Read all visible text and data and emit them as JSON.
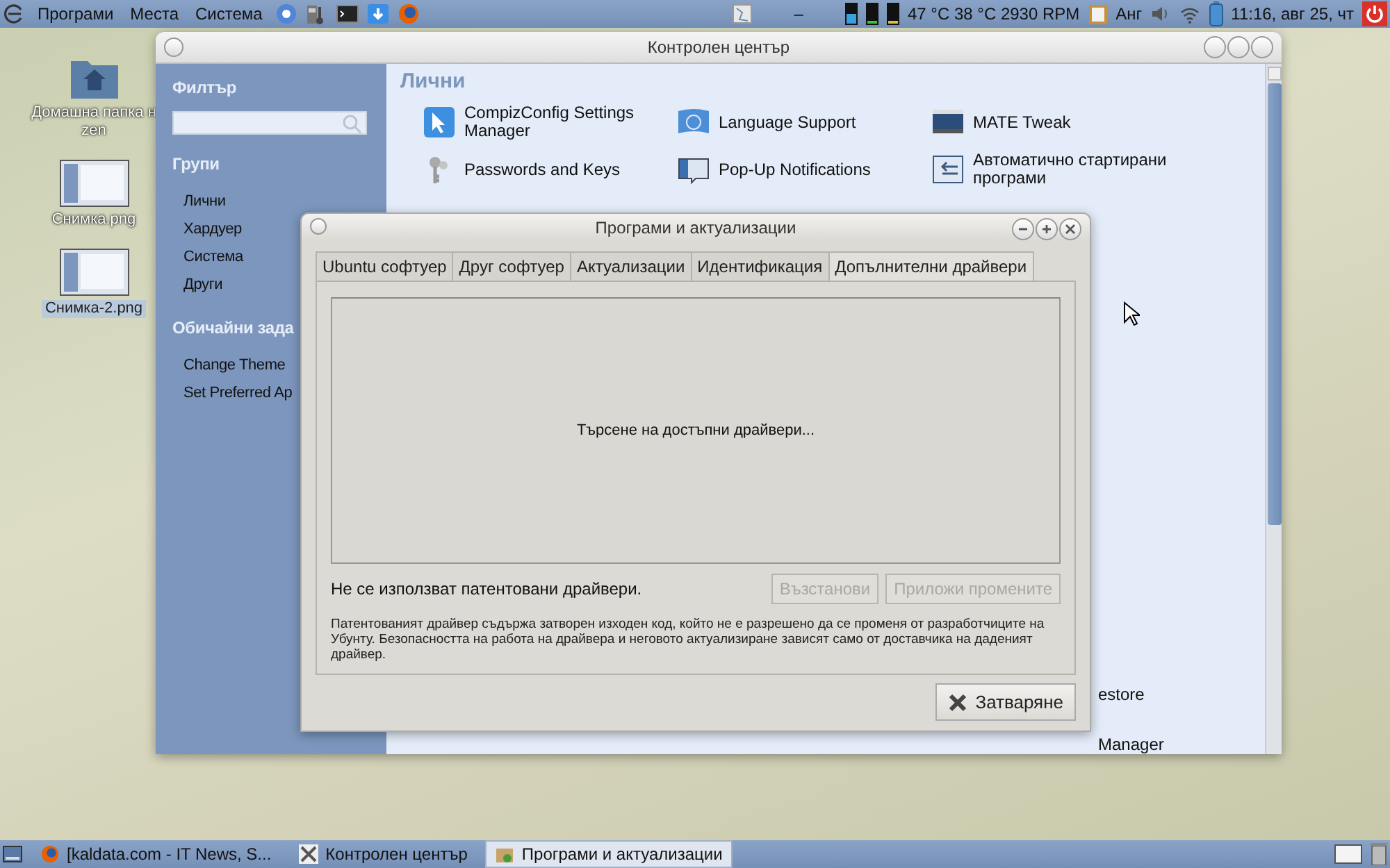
{
  "top_panel": {
    "menus": [
      "Програми",
      "Места",
      "Система"
    ],
    "sensors": "47 °C 38 °C 2930 RPM",
    "keyboard_layout": "Анг",
    "clock": "11:16, авг 25, чт",
    "minus": "–"
  },
  "desktop_icons": [
    {
      "kind": "folder",
      "lines": [
        "Домашна папка н",
        "zen"
      ],
      "selected": false
    },
    {
      "kind": "image",
      "lines": [
        "Снимка.png"
      ],
      "selected": false
    },
    {
      "kind": "image",
      "lines": [
        "Снимка-2.png"
      ],
      "selected": true
    }
  ],
  "control_center": {
    "title": "Контролен център",
    "filter_heading": "Филтър",
    "groups_heading": "Групи",
    "groups": [
      "Лични",
      "Хардуер",
      "Система",
      "Други"
    ],
    "tasks_heading": "Обичайни зада",
    "tasks": [
      "Change Theme",
      "Set Preferred Ap"
    ],
    "section_heading": "Лични",
    "items": [
      {
        "kind": "compiz",
        "label": "CompizConfig Settings Manager"
      },
      {
        "kind": "language",
        "label": "Language Support"
      },
      {
        "kind": "tweak",
        "label": "MATE Tweak"
      },
      {
        "kind": "keys",
        "label": "Passwords and Keys"
      },
      {
        "kind": "notify",
        "label": "Pop-Up Notifications"
      },
      {
        "kind": "autostart",
        "label": "Автоматично стартирани програми"
      }
    ],
    "partial_items": [
      "estore",
      "Manager"
    ]
  },
  "dialog": {
    "title": "Програми и актуализации",
    "tabs": [
      {
        "label": "Ubuntu софтуер",
        "selected": false
      },
      {
        "label": "Друг софтуер",
        "selected": false
      },
      {
        "label": "Актуализации",
        "selected": false
      },
      {
        "label": "Идентификация",
        "selected": false
      },
      {
        "label": "Допълнителни драйвери",
        "selected": true
      }
    ],
    "status": "Търсене на достъпни драйвери...",
    "info": "Не се използват патентовани драйвери.",
    "buttons": [
      {
        "label": "Възстанови",
        "disabled": true
      },
      {
        "label": "Приложи промените",
        "disabled": true
      }
    ],
    "note": "Патентованият драйвер съдържа затворен изходен код, който не е разрешено да се променя от разработчиците на Убунту. Безопасността на работа на драйвера и неговото актуализиране зависят само от доставчика на даденият драйвер.",
    "close_button": "Затваряне"
  },
  "taskbar": {
    "items": [
      {
        "kind": "browser",
        "label": "[kaldata.com - IT News, S...",
        "selected": false
      },
      {
        "kind": "settings",
        "label": "Контролен център",
        "selected": false
      },
      {
        "kind": "software",
        "label": "Програми и актуализации",
        "selected": true
      }
    ]
  }
}
